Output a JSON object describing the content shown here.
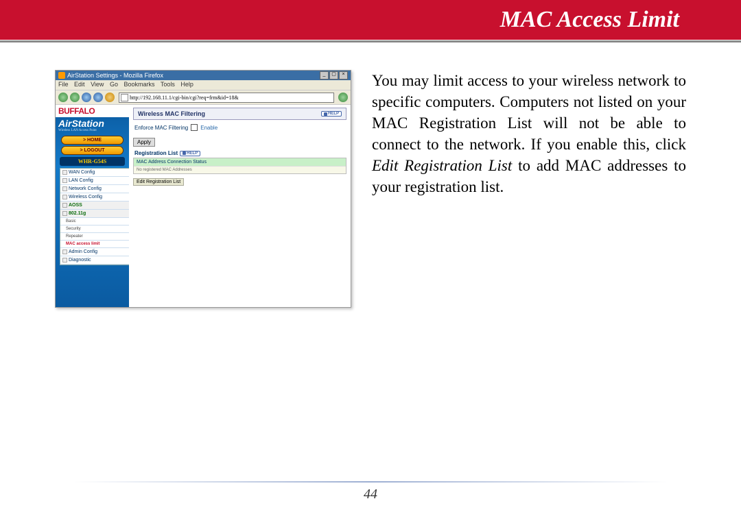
{
  "header": {
    "title": "MAC Access Limit"
  },
  "browser": {
    "title": "AirStation Settings - Mozilla Firefox",
    "menus": [
      "File",
      "Edit",
      "View",
      "Go",
      "Bookmarks",
      "Tools",
      "Help"
    ],
    "url": "http://192.168.11.1/cgi-bin/cgi?req=frm&id=18&"
  },
  "sidebar": {
    "brand": "BUFFALO",
    "product": "AirStation",
    "subtitle": "Wireless LAN Access Point",
    "home_btn": "> HOME",
    "logout_btn": "> LOGOUT",
    "model": "WHR-G54S",
    "items": [
      {
        "label": "WAN Config"
      },
      {
        "label": "LAN Config"
      },
      {
        "label": "Network Config"
      },
      {
        "label": "Wireless Config"
      }
    ],
    "group1": "AOSS",
    "group2": "802.11g",
    "subitems": [
      {
        "label": "Basic"
      },
      {
        "label": "Security"
      },
      {
        "label": "Repeater"
      }
    ],
    "active": "MAC access limit",
    "items2": [
      {
        "label": "Admin Config"
      },
      {
        "label": "Diagnostic"
      }
    ]
  },
  "panel": {
    "title": "Wireless MAC Filtering",
    "help": "HELP",
    "enforce_label": "Enforce MAC Filtering",
    "enforce_box": "Enable",
    "apply": "Apply",
    "reg_title": "Registration List",
    "reg_header": "MAC Address Connection Status",
    "reg_empty": "No registered MAC Addresses",
    "edit_btn": "Edit Registration List"
  },
  "explain": {
    "p1a": "You may limit access to your wireless network to specific computers. Computers not listed on your MAC Registration List will not be able to connect to the network.  If you enable this, click ",
    "p1_em": "Edit Registration List",
    "p1b": " to add MAC addresses to your registration list."
  },
  "page_number": "44"
}
